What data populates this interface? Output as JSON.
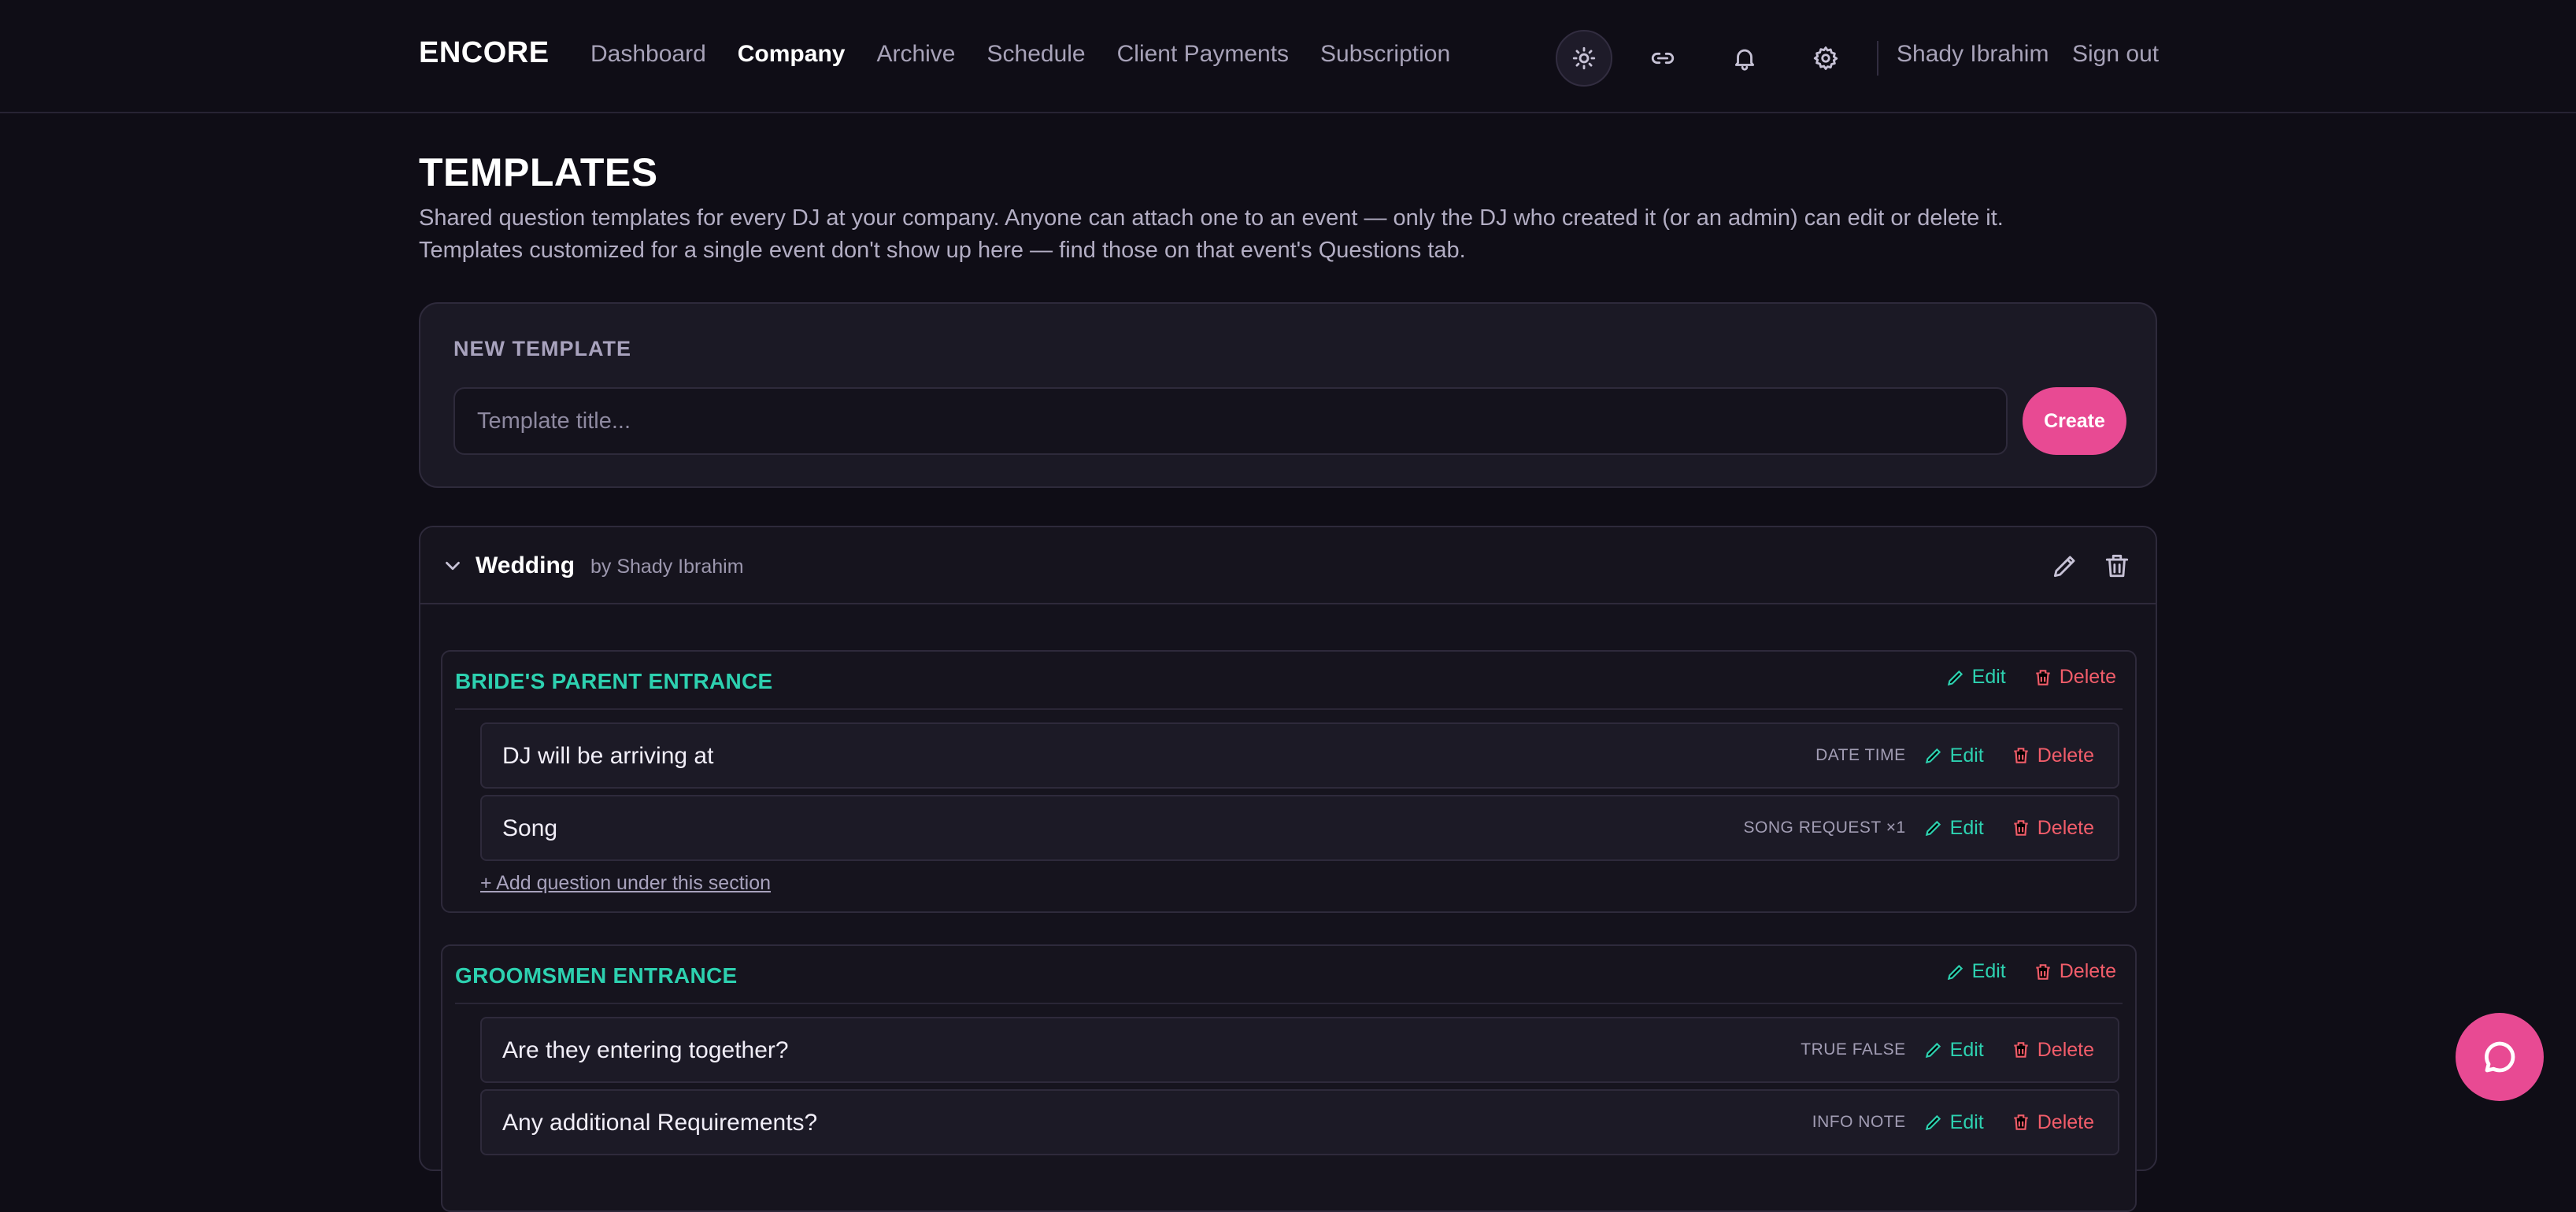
{
  "brand": "ENCORE",
  "nav": [
    "Dashboard",
    "Company",
    "Archive",
    "Schedule",
    "Client Payments",
    "Subscription"
  ],
  "nav_active": "Company",
  "header": {
    "icons": [
      "sun-icon",
      "link-icon",
      "bell-icon",
      "gear-icon"
    ],
    "user": "Shady Ibrahim",
    "signout": "Sign out"
  },
  "page": {
    "title": "TEMPLATES",
    "description_1": "Shared question templates for every DJ at your company. Anyone can attach one to an event — only the DJ who created it (or an admin) can edit or delete it.",
    "description_2": "Templates customized for a single event don't show up here — find those on that event's Questions tab."
  },
  "new_template": {
    "label": "NEW TEMPLATE",
    "placeholder": "Template title...",
    "value": "",
    "create_label": "Create"
  },
  "template": {
    "name": "Wedding",
    "author": "by Shady Ibrahim",
    "sections": [
      {
        "title": "BRIDE'S PARENT ENTRANCE",
        "edit_label": "Edit",
        "delete_label": "Delete",
        "questions": [
          {
            "text": "DJ will be arriving at",
            "type": "DATE TIME",
            "edit_label": "Edit",
            "delete_label": "Delete"
          },
          {
            "text": "Song",
            "type": "SONG REQUEST ×1",
            "edit_label": "Edit",
            "delete_label": "Delete"
          }
        ],
        "add_label": "+ Add question under this section"
      },
      {
        "title": "GROOMSMEN ENTRANCE",
        "edit_label": "Edit",
        "delete_label": "Delete",
        "questions": [
          {
            "text": "Are they entering together?",
            "type": "TRUE FALSE",
            "edit_label": "Edit",
            "delete_label": "Delete"
          },
          {
            "text": "Any additional Requirements?",
            "type": "INFO NOTE",
            "edit_label": "Edit",
            "delete_label": "Delete"
          }
        ]
      }
    ]
  },
  "colors": {
    "accent": "#e84a93",
    "teal": "#2dd1b0",
    "danger": "#f25d6a",
    "background": "#0f0d16"
  },
  "fab_icon": "chat-bubble-icon"
}
